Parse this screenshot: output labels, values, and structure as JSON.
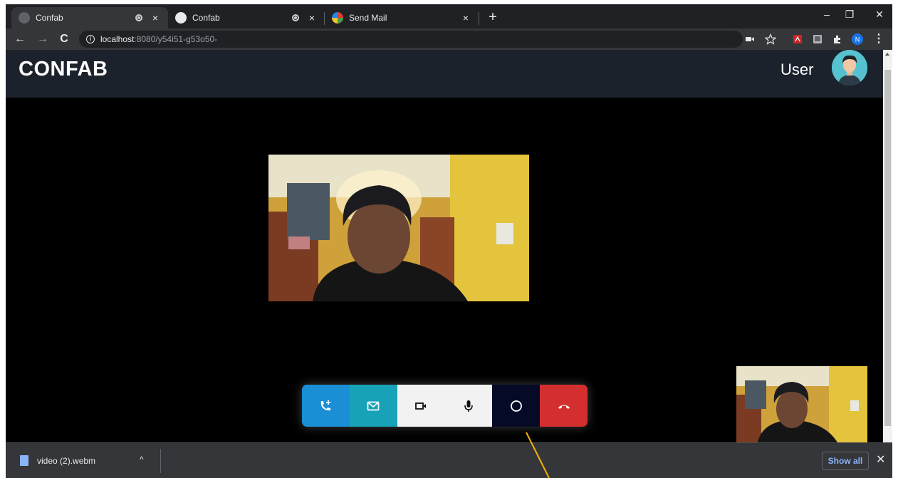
{
  "browser": {
    "tabs": [
      {
        "title": "Confab",
        "recording": true,
        "close": "×"
      },
      {
        "title": "Confab",
        "recording": true,
        "close": "×"
      },
      {
        "title": "Send Mail",
        "recording": false,
        "close": "×"
      }
    ],
    "new_tab": "+",
    "window_controls": {
      "minimize": "–",
      "restore": "❐",
      "close": "✕"
    },
    "nav": {
      "back": "←",
      "forward": "→",
      "reload": "C"
    },
    "url": {
      "host": "localhost",
      "path": ":8080/y54i51-g53o50-"
    },
    "profile_initial": "N",
    "menu": "⋮"
  },
  "app": {
    "brand": "CONFAB",
    "user_label": "User",
    "controls": [
      {
        "name": "add-call-button",
        "icon": "phone-add-icon",
        "color": "#1a8fd6"
      },
      {
        "name": "mail-button",
        "icon": "mail-icon",
        "color": "#17a2b8"
      },
      {
        "name": "camera-button",
        "icon": "video-camera-icon",
        "color": "#f2f2f2"
      },
      {
        "name": "mic-button",
        "icon": "microphone-icon",
        "color": "#f2f2f2"
      },
      {
        "name": "record-button",
        "icon": "circle-icon",
        "color": "#050a26"
      },
      {
        "name": "hangup-button",
        "icon": "phone-hangup-icon",
        "color": "#d32f2f"
      }
    ]
  },
  "downloads": {
    "file_name": "video (2).webm",
    "caret": "^",
    "show_all": "Show all",
    "close": "✕"
  }
}
